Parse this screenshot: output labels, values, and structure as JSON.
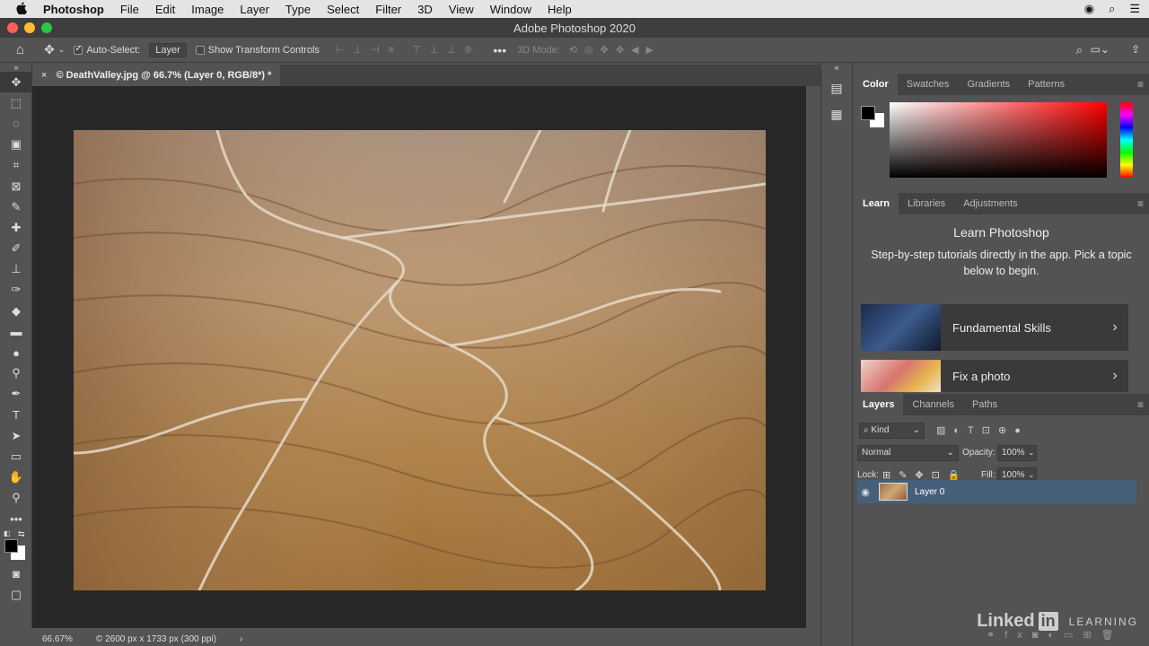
{
  "menubar": {
    "apple": "",
    "app_name": "Photoshop",
    "items": [
      "File",
      "Edit",
      "Image",
      "Layer",
      "Type",
      "Select",
      "Filter",
      "3D",
      "View",
      "Window",
      "Help"
    ]
  },
  "window": {
    "title": "Adobe Photoshop 2020"
  },
  "options_bar": {
    "auto_select_label": "Auto-Select:",
    "auto_select_value": "Layer",
    "transform_label": "Show Transform Controls",
    "mode_label": "3D Mode:"
  },
  "document_tab": {
    "label": "© DeathValley.jpg @ 66.7% (Layer 0, RGB/8*) *",
    "close": "×"
  },
  "status_bar": {
    "zoom": "66.67%",
    "info": "© 2600 px x 1733 px (300 ppi)",
    "arrow": "›"
  },
  "color_panel": {
    "tabs": [
      "Color",
      "Swatches",
      "Gradients",
      "Patterns"
    ],
    "foreground": "#000000",
    "background": "#ffffff",
    "hue_color": "#ff0000"
  },
  "learn_panel": {
    "tabs": [
      "Learn",
      "Libraries",
      "Adjustments"
    ],
    "title": "Learn Photoshop",
    "subtitle": "Step-by-step tutorials directly in the app. Pick a topic below to begin.",
    "cards": [
      {
        "label": "Fundamental Skills"
      },
      {
        "label": "Fix a photo"
      }
    ]
  },
  "layers_panel": {
    "tabs": [
      "Layers",
      "Channels",
      "Paths"
    ],
    "filter_kind": "Kind",
    "blend_mode": "Normal",
    "opacity_label": "Opacity:",
    "opacity_value": "100%",
    "lock_label": "Lock:",
    "fill_label": "Fill:",
    "fill_value": "100%",
    "layers": [
      {
        "name": "Layer 0",
        "visible": true,
        "selected": true
      }
    ]
  },
  "watermark": {
    "brand": "Linked",
    "in": "in",
    "suffix": "LEARNING"
  },
  "colors": {
    "accent_selected_layer": "#46607a",
    "workspace": "#282828",
    "panel": "#535353"
  }
}
